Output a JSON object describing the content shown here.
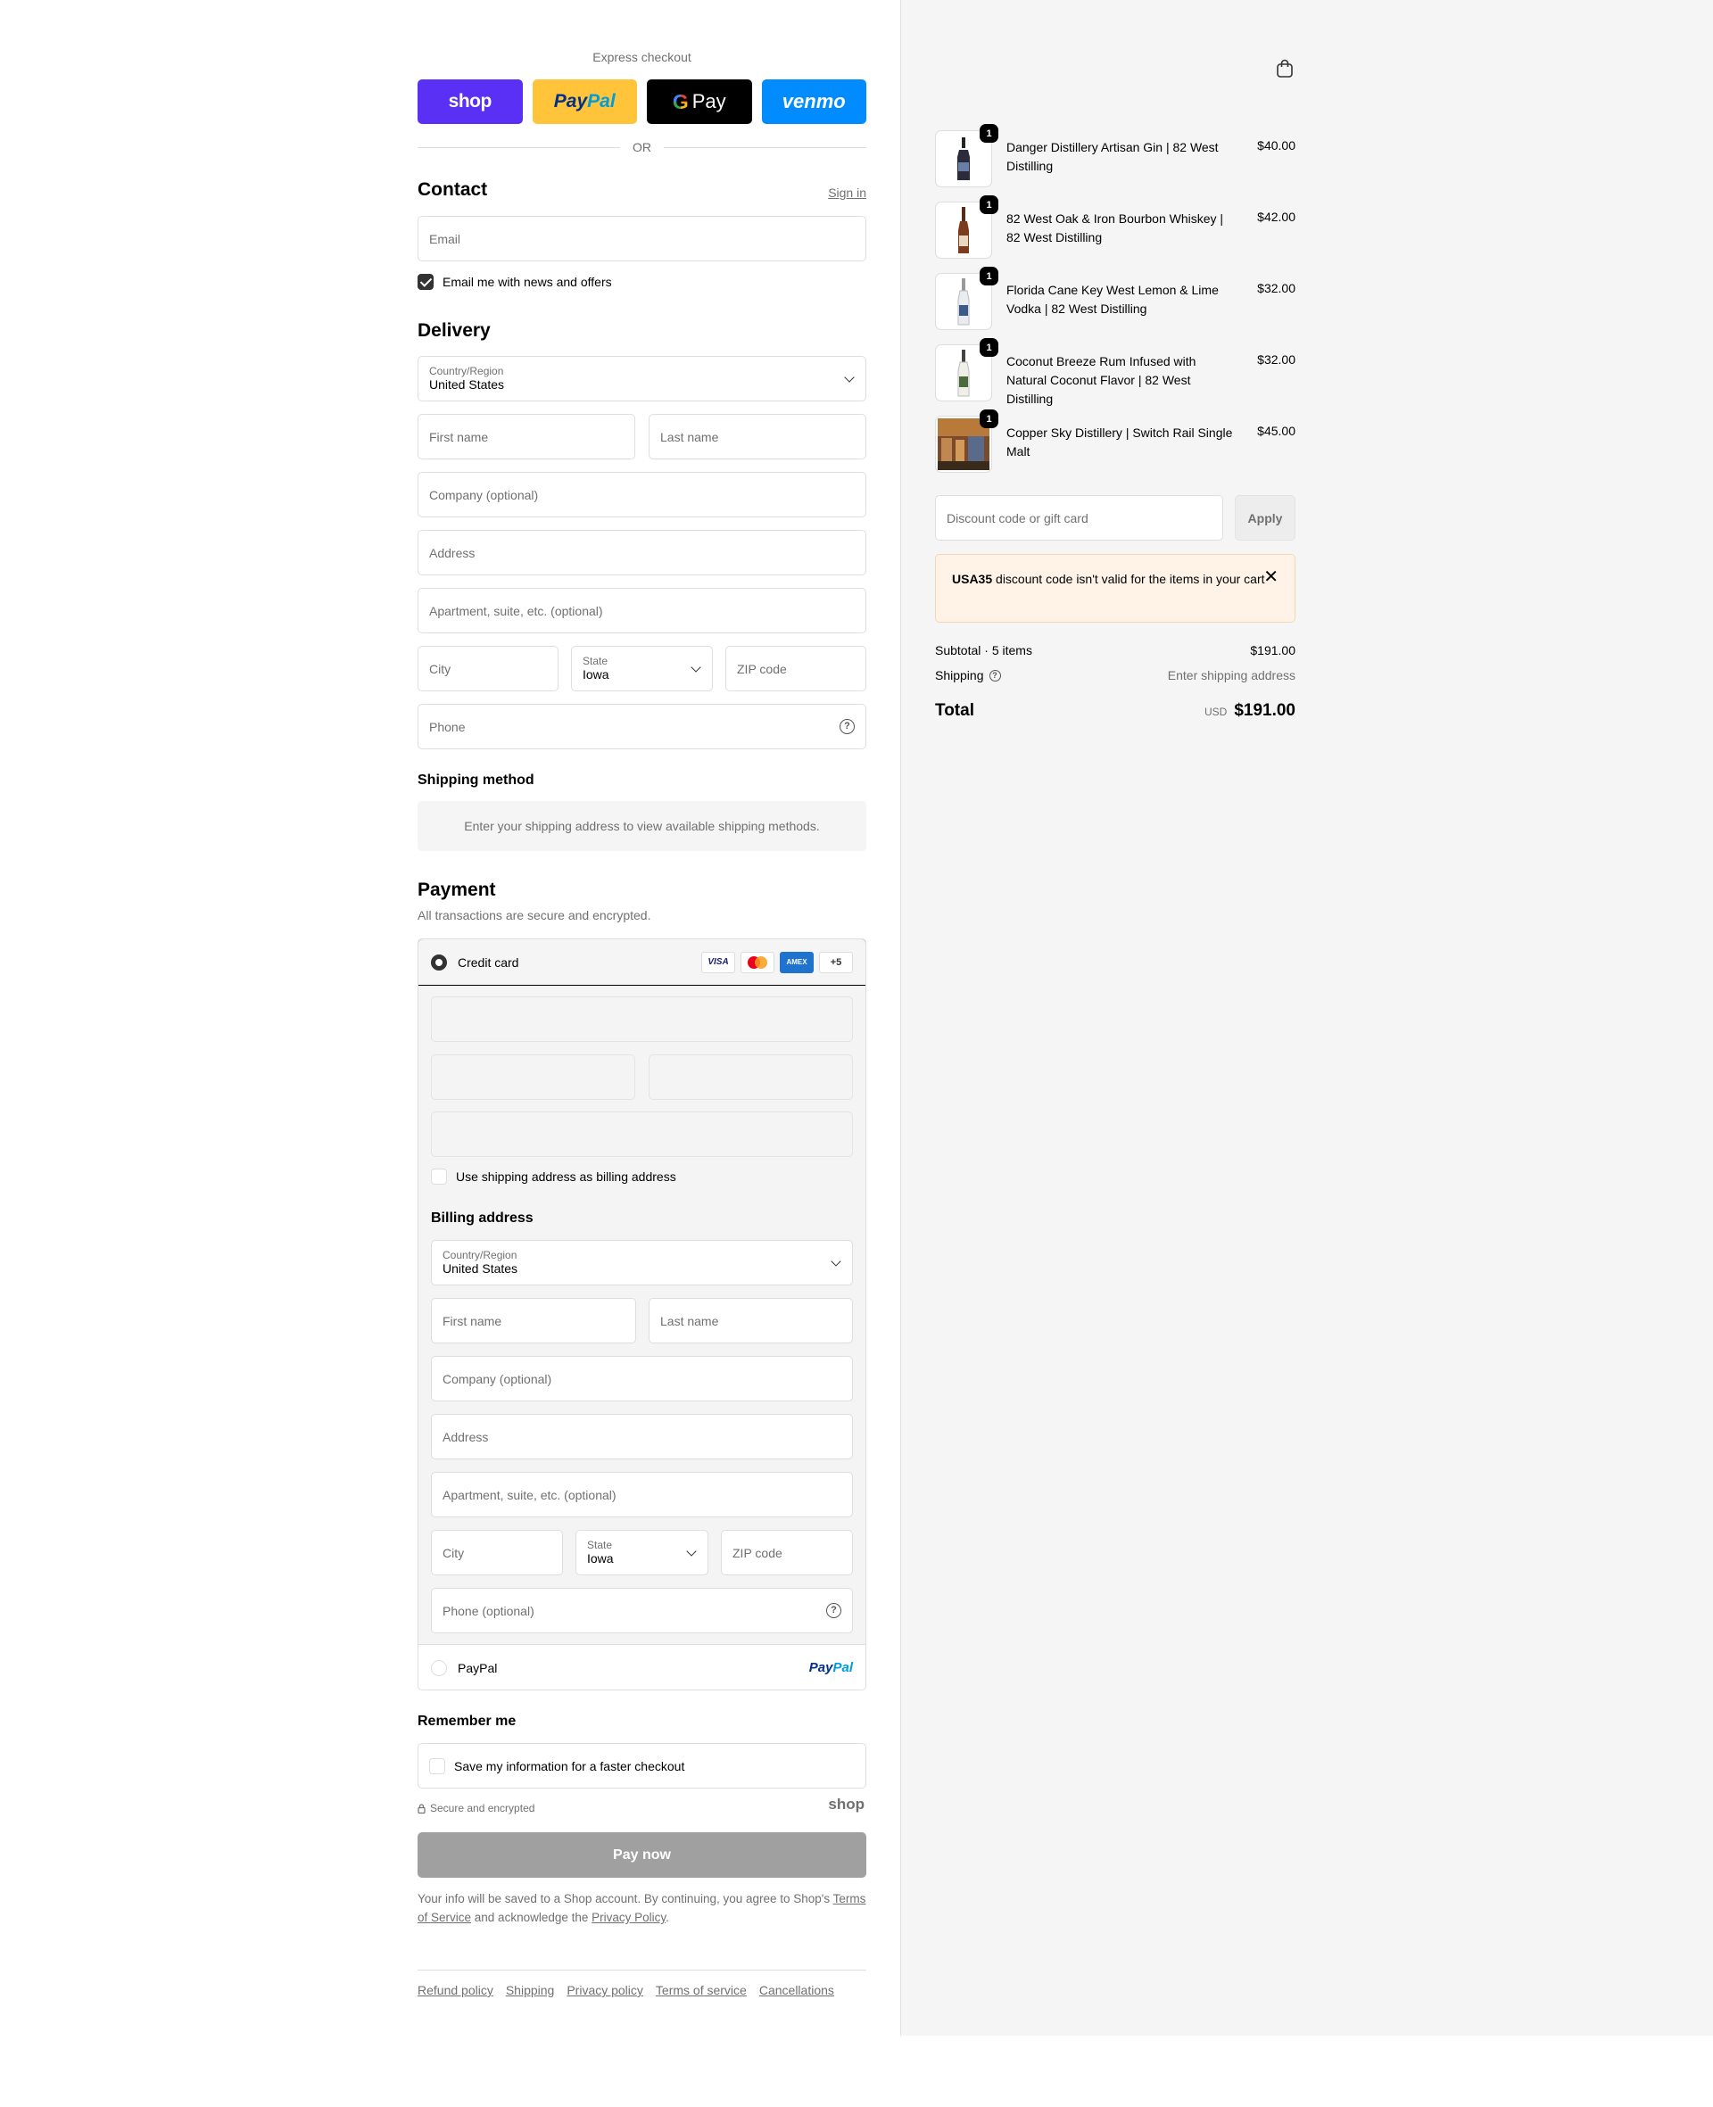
{
  "express": {
    "title": "Express checkout",
    "shop_label": "shop",
    "paypal_label_a": "Pay",
    "paypal_label_b": "Pal",
    "gpay_g": "G",
    "gpay_label": "Pay",
    "venmo_label": "venmo",
    "or_label": "OR"
  },
  "contact": {
    "title": "Contact",
    "sign_in": "Sign in",
    "email_placeholder": "Email",
    "newsletter_label": "Email me with news and offers",
    "newsletter_checked": true
  },
  "delivery": {
    "title": "Delivery",
    "country_label": "Country/Region",
    "country_value": "United States",
    "first_name": "First name",
    "last_name": "Last name",
    "company": "Company (optional)",
    "address": "Address",
    "apartment": "Apartment, suite, etc. (optional)",
    "city": "City",
    "state_label": "State",
    "state_value": "Iowa",
    "zip": "ZIP code",
    "phone": "Phone"
  },
  "shipping_method": {
    "title": "Shipping method",
    "message": "Enter your shipping address to view available shipping methods."
  },
  "payment": {
    "title": "Payment",
    "subtitle": "All transactions are secure and encrypted.",
    "credit_card_label": "Credit card",
    "card_visa": "VISA",
    "card_amex": "AMEX",
    "card_more": "+5",
    "billing_same_label": "Use shipping address as billing address",
    "billing_title": "Billing address",
    "billing": {
      "country_label": "Country/Region",
      "country_value": "United States",
      "first_name": "First name",
      "last_name": "Last name",
      "company": "Company (optional)",
      "address": "Address",
      "apartment": "Apartment, suite, etc. (optional)",
      "city": "City",
      "state_label": "State",
      "state_value": "Iowa",
      "zip": "ZIP code",
      "phone": "Phone (optional)"
    },
    "paypal_label": "PayPal",
    "paypal_logo_a": "Pay",
    "paypal_logo_b": "Pal"
  },
  "remember": {
    "title": "Remember me",
    "save_label": "Save my information for a faster checkout",
    "secure_label": "Secure and encrypted",
    "shop_logo": "shop"
  },
  "pay_button": "Pay now",
  "legal": {
    "text_1": "Your info will be saved to a Shop account. By continuing, you agree to Shop's ",
    "tos": "Terms of Service",
    "text_2": " and acknowledge the ",
    "privacy": "Privacy Policy",
    "text_3": "."
  },
  "footer": {
    "links": [
      "Refund policy",
      "Shipping",
      "Privacy policy",
      "Terms of service",
      "Cancellations"
    ]
  },
  "cart": {
    "items": [
      {
        "name": "Danger Distillery Artisan Gin | 82 West Distilling",
        "price": "$40.00",
        "qty": "1"
      },
      {
        "name": "82 West Oak & Iron Bourbon Whiskey | 82 West Distilling",
        "price": "$42.00",
        "qty": "1"
      },
      {
        "name": "Florida Cane Key West Lemon & Lime Vodka | 82 West Distilling",
        "price": "$32.00",
        "qty": "1"
      },
      {
        "name": "Coconut Breeze Rum Infused with Natural Coconut Flavor | 82 West Distilling",
        "price": "$32.00",
        "qty": "1"
      },
      {
        "name": "Copper Sky Distillery | Switch Rail Single Malt",
        "price": "$45.00",
        "qty": "1"
      }
    ],
    "discount_placeholder": "Discount code or gift card",
    "apply_label": "Apply",
    "alert_code": "USA35",
    "alert_text": " discount code isn't valid for the items in your cart",
    "subtotal_label": "Subtotal · 5 items",
    "subtotal_value": "$191.00",
    "shipping_label": "Shipping",
    "shipping_value": "Enter shipping address",
    "total_label": "Total",
    "currency": "USD",
    "total_value": "$191.00"
  }
}
